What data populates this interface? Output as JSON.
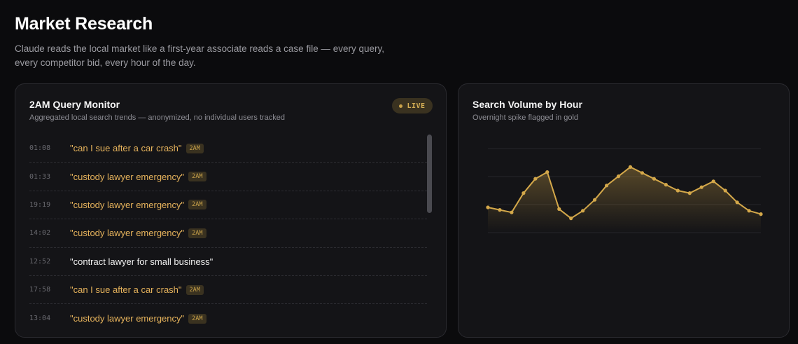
{
  "header": {
    "title": "Market Research",
    "subtitle": "Claude reads the local market like a first-year associate reads a case file — every query, every competitor bid, every hour of the day."
  },
  "monitor": {
    "title": "2AM Query Monitor",
    "subtitle": "Aggregated local search trends — anonymized, no individual users tracked",
    "badge": "LIVE",
    "rows": [
      {
        "time": "01:08",
        "query": "\"can I sue after a car crash\"",
        "tag": "2AM",
        "highlight": true
      },
      {
        "time": "01:33",
        "query": "\"custody lawyer emergency\"",
        "tag": "2AM",
        "highlight": true
      },
      {
        "time": "19:19",
        "query": "\"custody lawyer emergency\"",
        "tag": "2AM",
        "highlight": true
      },
      {
        "time": "14:02",
        "query": "\"custody lawyer emergency\"",
        "tag": "2AM",
        "highlight": true
      },
      {
        "time": "12:52",
        "query": "\"contract lawyer for small business\"",
        "tag": "",
        "highlight": false
      },
      {
        "time": "17:58",
        "query": "\"can I sue after a car crash\"",
        "tag": "2AM",
        "highlight": true
      },
      {
        "time": "13:04",
        "query": "\"custody lawyer emergency\"",
        "tag": "2AM",
        "highlight": true
      }
    ]
  },
  "volume": {
    "title": "Search Volume by Hour",
    "subtitle": "Overnight spike flagged in gold"
  },
  "chart_data": {
    "type": "area",
    "x": [
      0,
      1,
      2,
      3,
      4,
      5,
      6,
      7,
      8,
      9,
      10,
      11,
      12,
      13,
      14,
      15,
      16,
      17,
      18,
      19,
      20,
      21,
      22,
      23
    ],
    "values": [
      30,
      27,
      24,
      47,
      64,
      72,
      28,
      17,
      26,
      39,
      56,
      67,
      78,
      71,
      64,
      57,
      50,
      47,
      54,
      61,
      50,
      36,
      26,
      22
    ],
    "ylim": [
      0,
      100
    ],
    "grid": true,
    "colors": {
      "line": "#d4a84a",
      "fill": "#d4a84a"
    }
  }
}
